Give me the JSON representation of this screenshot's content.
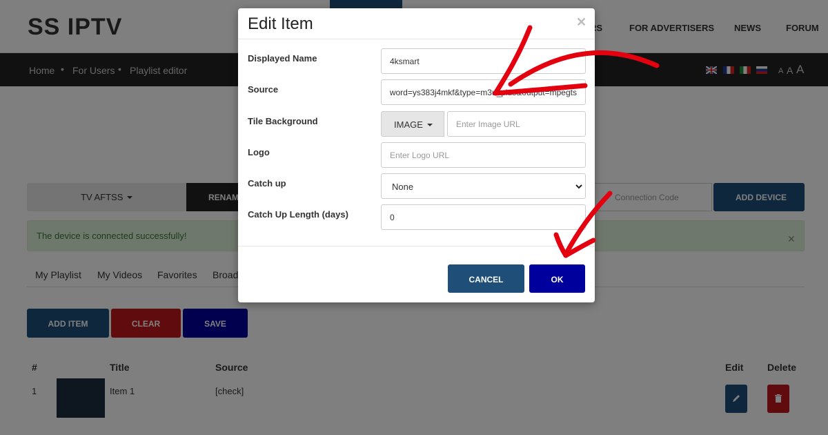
{
  "header": {
    "logo": "SS IPTV",
    "nav": [
      "RS",
      "FOR ADVERTISERS",
      "NEWS",
      "FORUM"
    ],
    "font_size_labels": [
      "A",
      "A",
      "A"
    ]
  },
  "breadcrumb": [
    "Home",
    "For Users",
    "Playlist editor"
  ],
  "device": {
    "selected": "TV AFTSS",
    "rename_label": "RENAM",
    "connection_placeholder": "Connection Code",
    "add_device_label": "ADD DEVICE",
    "alert": "The device is connected successfully!"
  },
  "tabs": [
    "My Playlist",
    "My Videos",
    "Favorites",
    "Broad"
  ],
  "actions": {
    "add_item": "ADD ITEM",
    "clear": "CLEAR",
    "save": "SAVE"
  },
  "table": {
    "headers": {
      "num": "#",
      "title": "Title",
      "source": "Source",
      "edit": "Edit",
      "delete": "Delete"
    },
    "rows": [
      {
        "num": "1",
        "title": "Item 1",
        "source": "[check]"
      }
    ]
  },
  "modal": {
    "title": "Edit Item",
    "fields": {
      "displayed_name": {
        "label": "Displayed Name",
        "value": "4ksmart"
      },
      "source": {
        "label": "Source",
        "value": "word=ys383j4mkf&type=m3u_plus&output=mpegts"
      },
      "tile_background": {
        "label": "Tile Background",
        "type_label": "IMAGE",
        "placeholder": "Enter Image URL"
      },
      "logo": {
        "label": "Logo",
        "placeholder": "Enter Logo URL"
      },
      "catch_up": {
        "label": "Catch up",
        "value": "None"
      },
      "catch_up_length": {
        "label": "Catch Up Length (days)",
        "value": "0"
      }
    },
    "cancel_label": "CANCEL",
    "ok_label": "OK"
  },
  "colors": {
    "primary_blue": "#1f4f78",
    "ok_blue": "#00009c",
    "danger_red": "#c0181e",
    "annotation_red": "#e3000f"
  }
}
